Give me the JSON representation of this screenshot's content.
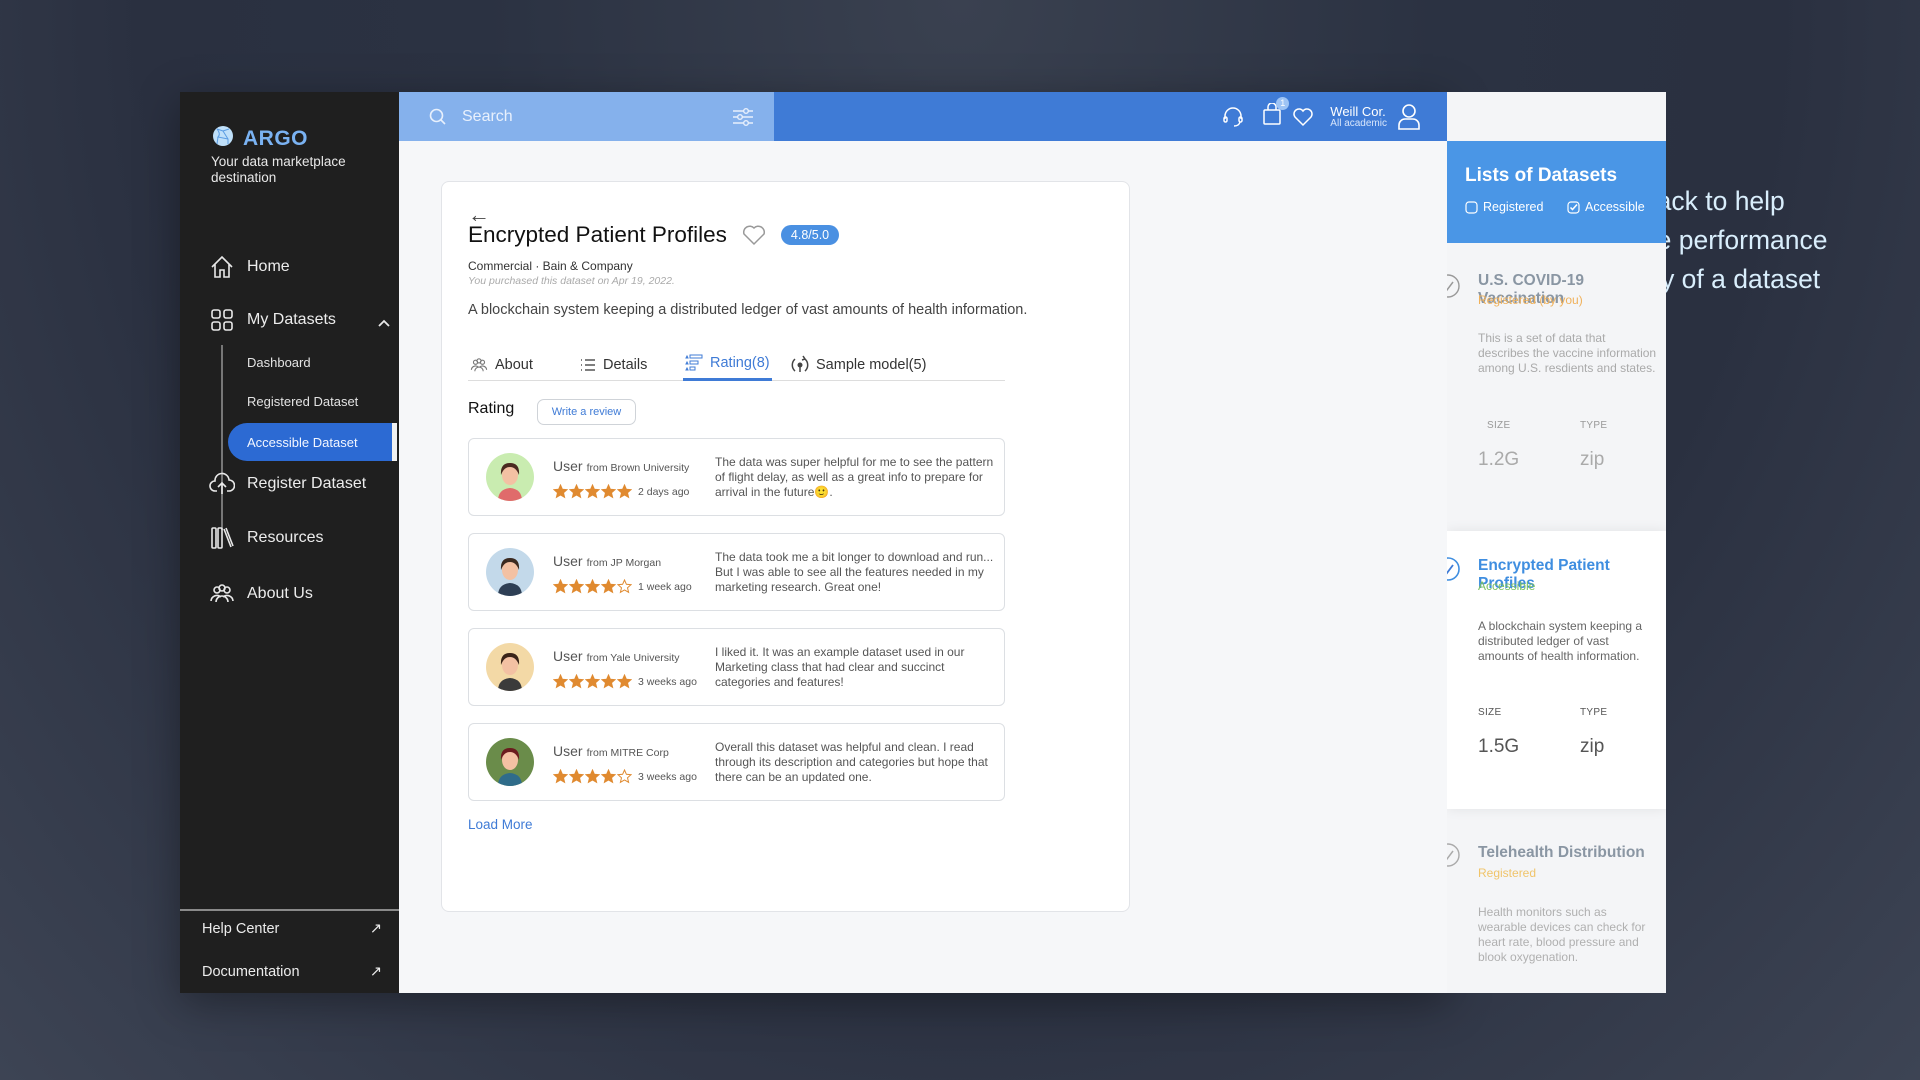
{
  "app": {
    "brand": "ARGO",
    "tagline": "Your data marketplace destination"
  },
  "sidebar": {
    "items": [
      {
        "label": "Home",
        "icon": "home-icon"
      },
      {
        "label": "My Datasets",
        "icon": "grid-icon",
        "expanded": true
      },
      {
        "label": "Register Dataset",
        "icon": "cloud-upload-icon"
      },
      {
        "label": "Resources",
        "icon": "library-icon"
      },
      {
        "label": "About Us",
        "icon": "group-icon"
      }
    ],
    "sub_items": [
      {
        "label": "Dashboard"
      },
      {
        "label": "Registered Dataset"
      },
      {
        "label": "Accessible Dataset",
        "active": true
      }
    ],
    "footer": [
      {
        "label": "Help Center",
        "icon": "↗"
      },
      {
        "label": "Documentation",
        "icon": "↗"
      }
    ]
  },
  "topbar": {
    "search_placeholder": "Search",
    "cart_count": "1",
    "user_name": "Weill Cor.",
    "user_org": "All academic"
  },
  "dataset": {
    "title": "Encrypted Patient Profiles",
    "rating": "4.8/5.0",
    "meta": "Commercial · Bain & Company",
    "purchased": "You purchased this dataset on Apr 19, 2022.",
    "description": "A blockchain system keeping a distributed ledger of vast amounts of health information.",
    "tabs": [
      {
        "label": "About",
        "icon": "group-icon"
      },
      {
        "label": "Details",
        "icon": "list-icon"
      },
      {
        "label": "Rating(8)",
        "icon": "rating-list-icon",
        "active": true
      },
      {
        "label": "Sample model(5)",
        "icon": "model-icon"
      }
    ]
  },
  "ratings": {
    "heading": "Rating",
    "write_review": "Write a review",
    "load_more": "Load More",
    "reviews": [
      {
        "user": "User",
        "from": "from Brown University",
        "stars": 5,
        "time": "2 days ago",
        "text": "The data was super helpful for me to see the pattern of flight delay, as well as a great info to prepare for arrival in the future🙂.",
        "avatar_bg": "#c9ecb0"
      },
      {
        "user": "User",
        "from": "from JP Morgan",
        "stars": 4,
        "time": "1 week ago",
        "text": "The data took me a bit longer to download and run... But I was able to see all the features needed in my marketing research. Great one!",
        "avatar_bg": "#c3d9ea"
      },
      {
        "user": "User",
        "from": "from Yale University",
        "stars": 5,
        "time": "3 weeks ago",
        "text": "I liked it. It was an example dataset used in our Marketing class that had clear and succinct categories and features!",
        "avatar_bg": "#f3d9a6"
      },
      {
        "user": "User",
        "from": "from MITRE Corp",
        "stars": 4,
        "time": "3 weeks ago",
        "text": "Overall this dataset was helpful and clean. I read through its description and categories but hope that there can be an updated one.",
        "avatar_bg": "#6a8c4a"
      }
    ]
  },
  "list_panel": {
    "title": "Lists of Datasets",
    "filters": [
      {
        "label": "Registered",
        "checked": false
      },
      {
        "label": "Accessible",
        "checked": true
      }
    ],
    "size_label": "SIZE",
    "type_label": "TYPE",
    "datasets": [
      {
        "name": "U.S. COVID-19 Vaccination",
        "status": "Registered (by you)",
        "description": "This is a set of data that describes the vaccine information among U.S. resdients and states.",
        "size": "1.2G",
        "type": "zip",
        "selected": false
      },
      {
        "name": "Encrypted Patient Profiles",
        "status": "Accessible",
        "description": "A blockchain system keeping a distributed ledger of vast amounts of health information.",
        "size": "1.5G",
        "type": "zip",
        "selected": true
      },
      {
        "name": "Telehealth Distribution",
        "status": "Registered",
        "description": "Health monitors such as wearable devices can check for heart rate, blood pressure and blook oxygenation.",
        "selected": false
      }
    ]
  },
  "caption": "User feedback to help evaluate the performance and usability of a dataset",
  "colors": {
    "accent": "#3f7bd6",
    "search_bg": "#85b1ec",
    "sidebar_bg": "#1f1f1f",
    "star": "#e08a30",
    "registered": "#f0b15a",
    "accessible": "#7cc063"
  }
}
